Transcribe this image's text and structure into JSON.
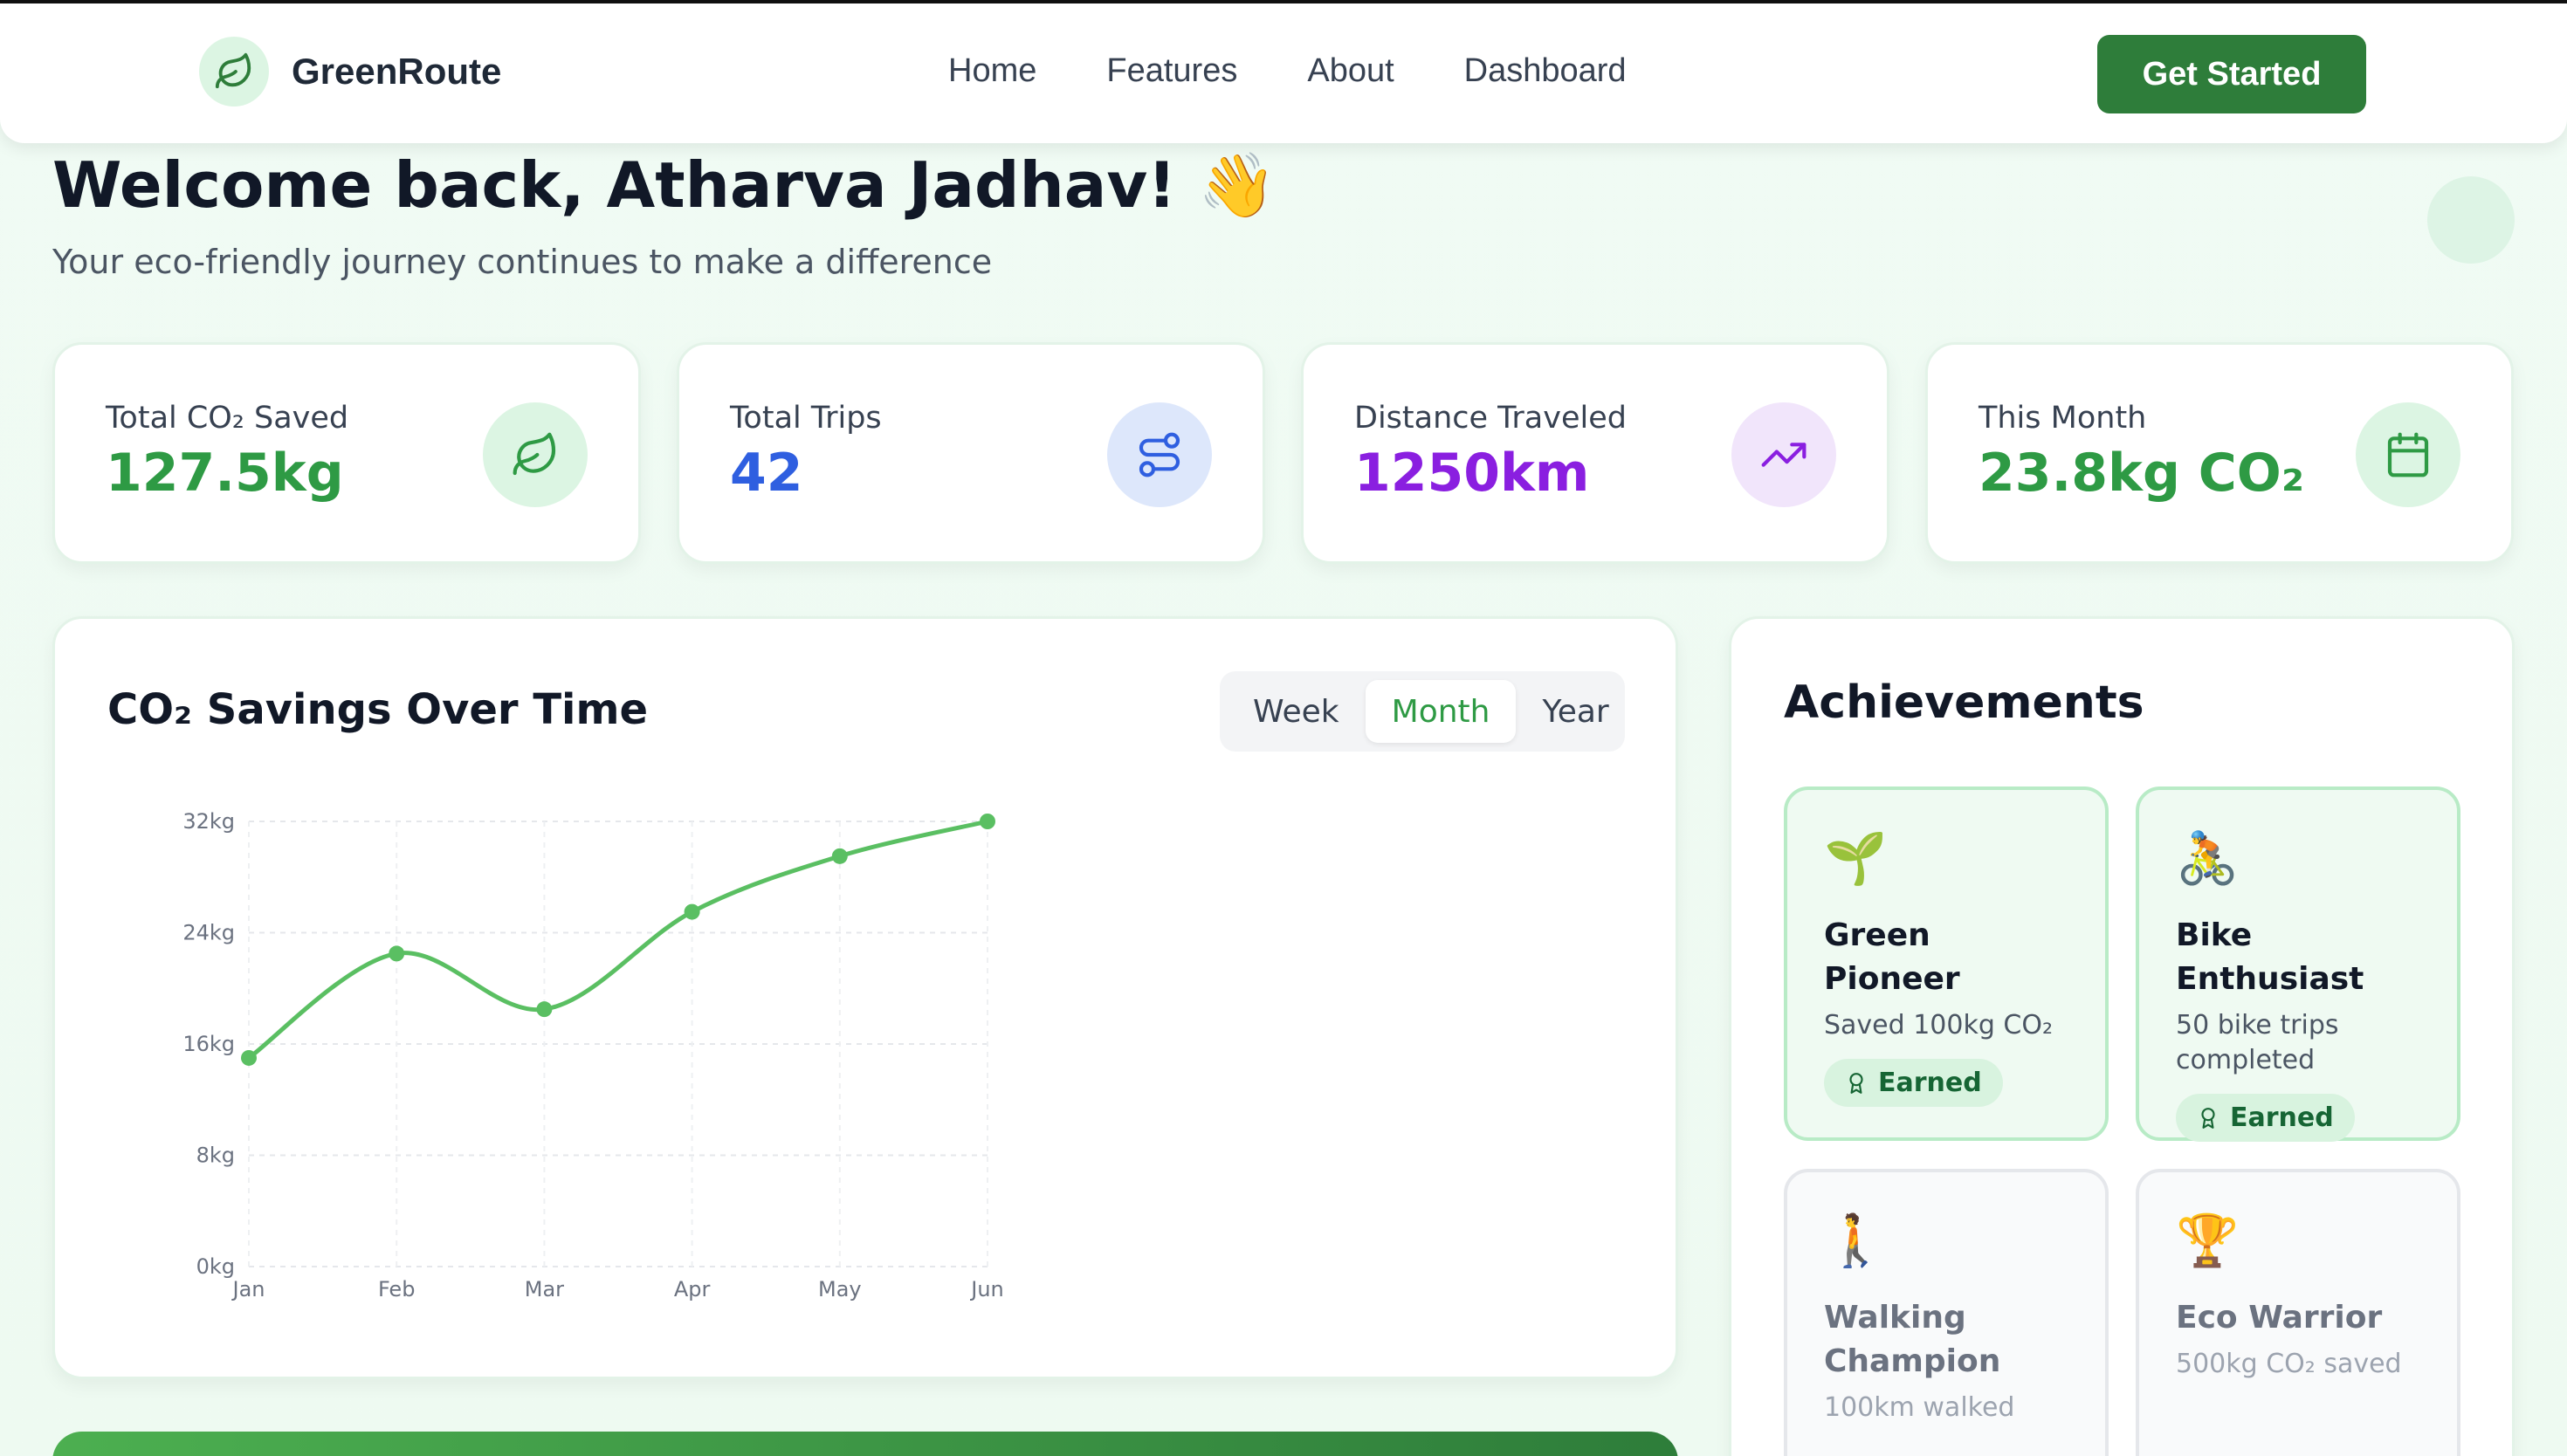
{
  "nav": {
    "brand": "GreenRoute",
    "links": [
      "Home",
      "Features",
      "About",
      "Dashboard"
    ],
    "cta": "Get Started"
  },
  "header": {
    "welcome": "Welcome back, Atharva Jadhav! 👋",
    "subtitle": "Your eco-friendly journey continues to make a difference"
  },
  "stats": [
    {
      "label": "Total CO₂ Saved",
      "value": "127.5kg",
      "color": "#2e9a44",
      "icon": "leaf-icon",
      "icon_bg": "#dcf5e3"
    },
    {
      "label": "Total Trips",
      "value": "42",
      "color": "#2f5fe0",
      "icon": "route-icon",
      "icon_bg": "#dde7fb"
    },
    {
      "label": "Distance Traveled",
      "value": "1250km",
      "color": "#8a1fe0",
      "icon": "trending-up-icon",
      "icon_bg": "#f1e5fb"
    },
    {
      "label": "This Month",
      "value": "23.8kg CO₂",
      "color": "#2e9a44",
      "icon": "calendar-icon",
      "icon_bg": "#dcf5e3"
    }
  ],
  "chart_card": {
    "title": "CO₂ Savings Over Time",
    "ranges": [
      "Week",
      "Month",
      "Year"
    ],
    "active_range": "Month"
  },
  "chart_data": {
    "type": "line",
    "categories": [
      "Jan",
      "Feb",
      "Mar",
      "Apr",
      "May",
      "Jun"
    ],
    "values": [
      15,
      22.5,
      18.5,
      25.5,
      29.5,
      32
    ],
    "ylim": [
      0,
      32
    ],
    "yticks": [
      "0kg",
      "8kg",
      "16kg",
      "24kg",
      "32kg"
    ],
    "ytick_values": [
      0,
      8,
      16,
      24,
      32
    ],
    "grid": true,
    "color": "#5abf62"
  },
  "achievements": {
    "title": "Achievements",
    "items": [
      {
        "emoji": "🌱",
        "name": "Green Pioneer",
        "desc": "Saved 100kg CO₂",
        "badge": "Earned",
        "earned": true
      },
      {
        "emoji": "🚴",
        "name": "Bike Enthusiast",
        "desc": "50 bike trips completed",
        "badge": "Earned",
        "earned": true
      },
      {
        "emoji": "🚶",
        "name": "Walking Champion",
        "desc": "100km walked",
        "badge": "",
        "earned": false
      },
      {
        "emoji": "🏆",
        "name": "Eco Warrior",
        "desc": "500kg CO₂ saved",
        "badge": "",
        "earned": false
      }
    ]
  }
}
